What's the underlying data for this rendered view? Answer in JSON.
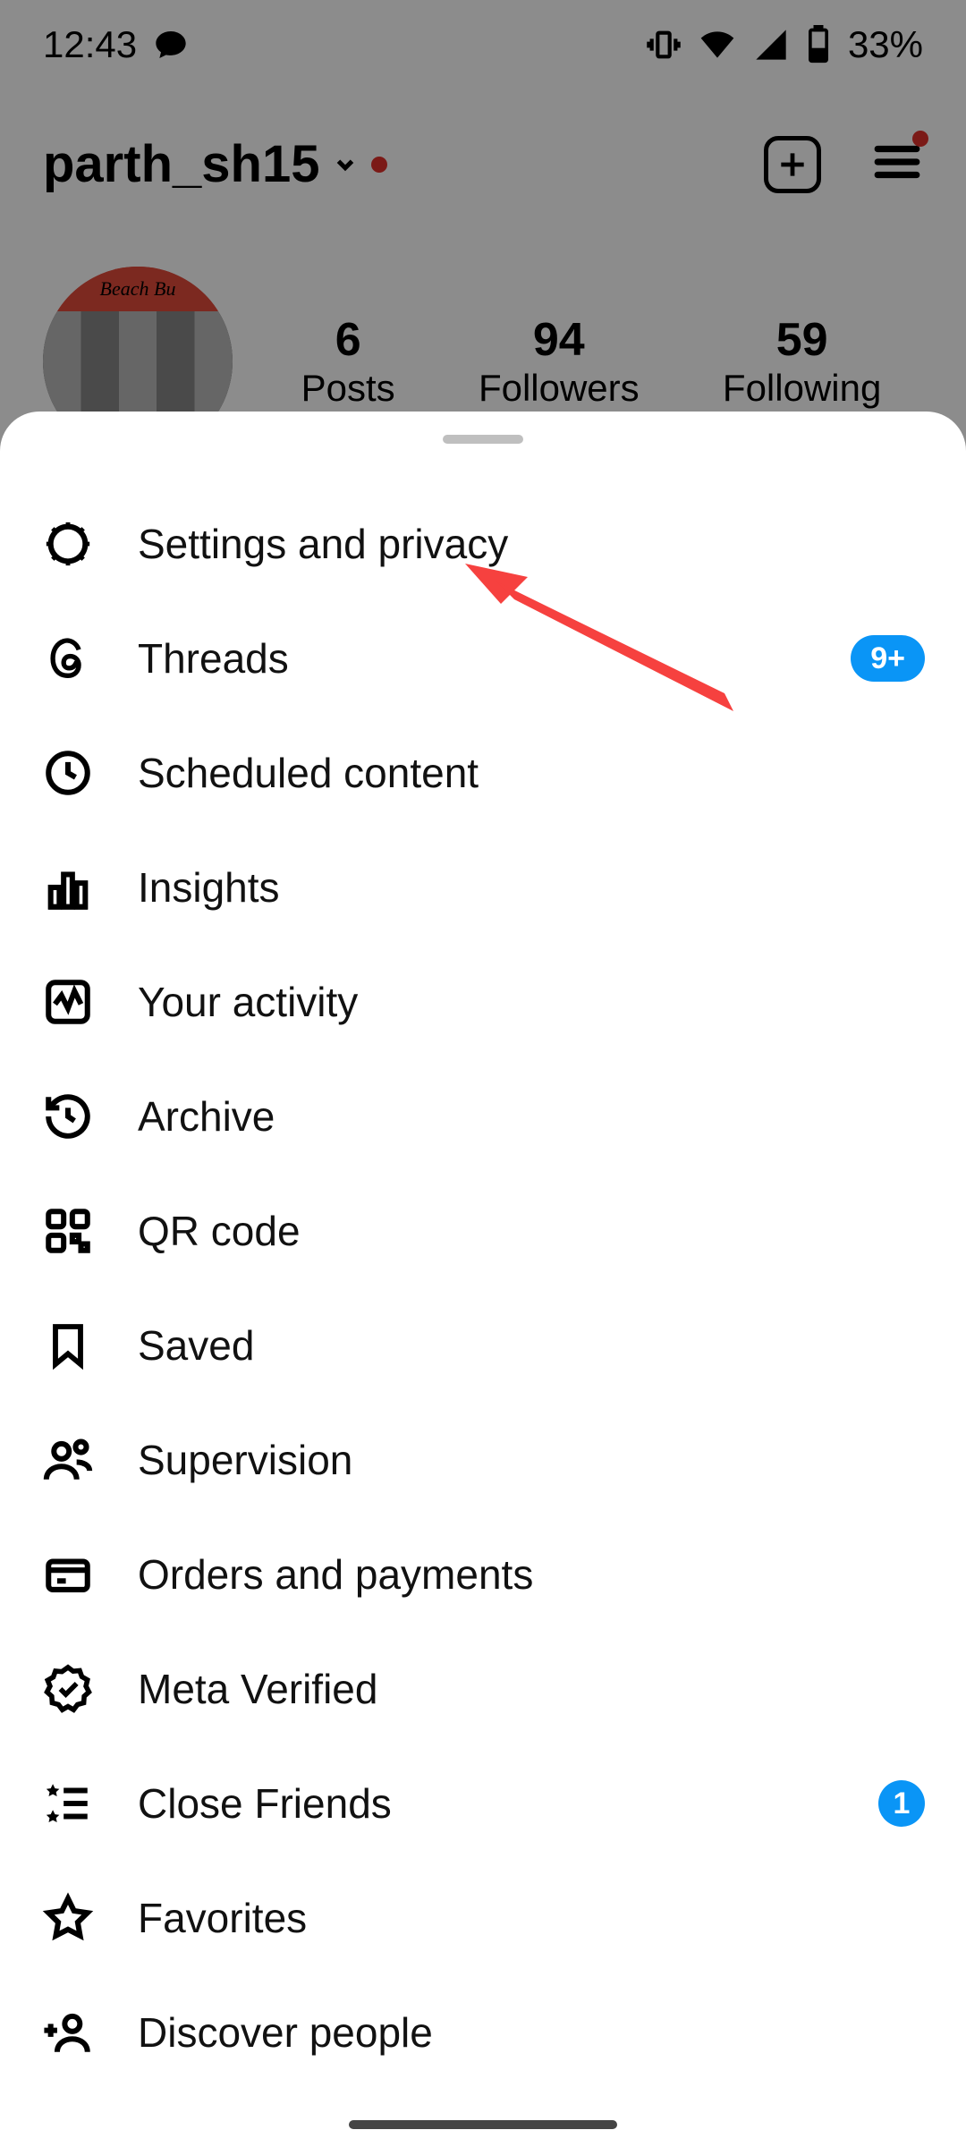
{
  "status": {
    "time": "12:43",
    "battery_pct": "33%"
  },
  "profile": {
    "username": "parth_sh15",
    "stats": {
      "posts": {
        "count": "6",
        "label": "Posts"
      },
      "followers": {
        "count": "94",
        "label": "Followers"
      },
      "following": {
        "count": "59",
        "label": "Following"
      }
    }
  },
  "menu": {
    "settings": {
      "label": "Settings and privacy"
    },
    "threads": {
      "label": "Threads",
      "badge": "9+"
    },
    "scheduled": {
      "label": "Scheduled content"
    },
    "insights": {
      "label": "Insights"
    },
    "activity": {
      "label": "Your activity"
    },
    "archive": {
      "label": "Archive"
    },
    "qr": {
      "label": "QR code"
    },
    "saved": {
      "label": "Saved"
    },
    "supervision": {
      "label": "Supervision"
    },
    "orders": {
      "label": "Orders and payments"
    },
    "verified": {
      "label": "Meta Verified"
    },
    "close": {
      "label": "Close Friends",
      "badge": "1"
    },
    "favorites": {
      "label": "Favorites"
    },
    "discover": {
      "label": "Discover people"
    }
  }
}
